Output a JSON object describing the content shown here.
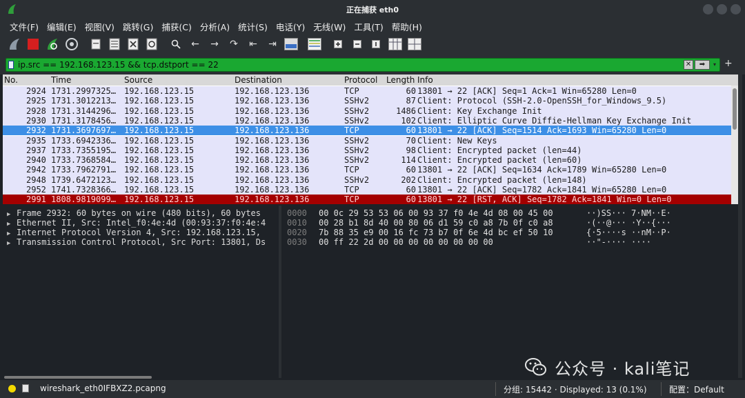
{
  "window": {
    "title": "正在捕获 eth0"
  },
  "menu": [
    "文件(F)",
    "编辑(E)",
    "视图(V)",
    "跳转(G)",
    "捕获(C)",
    "分析(A)",
    "统计(S)",
    "电话(Y)",
    "无线(W)",
    "工具(T)",
    "帮助(H)"
  ],
  "toolbar": {
    "icons": [
      "shark-fin-start-icon",
      "stop-capture-icon",
      "restart-capture-icon",
      "capture-options-icon",
      "open-file-icon",
      "save-file-icon",
      "close-file-icon",
      "reload-file-icon",
      "find-packet-icon",
      "go-back-icon",
      "go-forward-icon",
      "go-to-packet-icon",
      "first-packet-icon",
      "last-packet-icon",
      "autoscroll-icon",
      "colorize-icon",
      "zoom-in-icon",
      "zoom-out-icon",
      "normal-size-icon",
      "resize-columns-icon",
      "layout-icon"
    ]
  },
  "filter": {
    "expression": "ip.src == 192.168.123.15 && tcp.dstport == 22"
  },
  "columns": {
    "no": "No.",
    "time": "Time",
    "source": "Source",
    "destination": "Destination",
    "protocol": "Protocol",
    "length": "Length",
    "info": "Info"
  },
  "colors": {
    "row_default": "#e4e4fa",
    "row_selected": "#3d8fe6",
    "row_rst": "#a40000",
    "filter_valid": "#1aa831"
  },
  "packets": [
    {
      "no": "2924",
      "time": "1731.2997325…",
      "source": "192.168.123.15",
      "destination": "192.168.123.136",
      "protocol": "TCP",
      "length": "60",
      "info": "13801 → 22 [ACK] Seq=1 Ack=1 Win=65280 Len=0",
      "state": "normal"
    },
    {
      "no": "2925",
      "time": "1731.3012213…",
      "source": "192.168.123.15",
      "destination": "192.168.123.136",
      "protocol": "SSHv2",
      "length": "87",
      "info": "Client: Protocol (SSH-2.0-OpenSSH_for_Windows_9.5)",
      "state": "normal"
    },
    {
      "no": "2928",
      "time": "1731.3144296…",
      "source": "192.168.123.15",
      "destination": "192.168.123.136",
      "protocol": "SSHv2",
      "length": "1486",
      "info": "Client: Key Exchange Init",
      "state": "normal"
    },
    {
      "no": "2930",
      "time": "1731.3178456…",
      "source": "192.168.123.15",
      "destination": "192.168.123.136",
      "protocol": "SSHv2",
      "length": "102",
      "info": "Client: Elliptic Curve Diffie-Hellman Key Exchange Init",
      "state": "normal"
    },
    {
      "no": "2932",
      "time": "1731.3697697…",
      "source": "192.168.123.15",
      "destination": "192.168.123.136",
      "protocol": "TCP",
      "length": "60",
      "info": "13801 → 22 [ACK] Seq=1514 Ack=1693 Win=65280 Len=0",
      "state": "selected"
    },
    {
      "no": "2935",
      "time": "1733.6942336…",
      "source": "192.168.123.15",
      "destination": "192.168.123.136",
      "protocol": "SSHv2",
      "length": "70",
      "info": "Client: New Keys",
      "state": "normal"
    },
    {
      "no": "2937",
      "time": "1733.7355195…",
      "source": "192.168.123.15",
      "destination": "192.168.123.136",
      "protocol": "SSHv2",
      "length": "98",
      "info": "Client: Encrypted packet (len=44)",
      "state": "normal"
    },
    {
      "no": "2940",
      "time": "1733.7368584…",
      "source": "192.168.123.15",
      "destination": "192.168.123.136",
      "protocol": "SSHv2",
      "length": "114",
      "info": "Client: Encrypted packet (len=60)",
      "state": "normal"
    },
    {
      "no": "2942",
      "time": "1733.7962791…",
      "source": "192.168.123.15",
      "destination": "192.168.123.136",
      "protocol": "TCP",
      "length": "60",
      "info": "13801 → 22 [ACK] Seq=1634 Ack=1789 Win=65280 Len=0",
      "state": "normal"
    },
    {
      "no": "2948",
      "time": "1739.6472123…",
      "source": "192.168.123.15",
      "destination": "192.168.123.136",
      "protocol": "SSHv2",
      "length": "202",
      "info": "Client: Encrypted packet (len=148)",
      "state": "normal"
    },
    {
      "no": "2952",
      "time": "1741.7328366…",
      "source": "192.168.123.15",
      "destination": "192.168.123.136",
      "protocol": "TCP",
      "length": "60",
      "info": "13801 → 22 [ACK] Seq=1782 Ack=1841 Win=65280 Len=0",
      "state": "normal"
    },
    {
      "no": "2991",
      "time": "1808.9819099…",
      "source": "192.168.123.15",
      "destination": "192.168.123.136",
      "protocol": "TCP",
      "length": "60",
      "info": "13801 → 22 [RST, ACK] Seq=1782 Ack=1841 Win=0 Len=0",
      "state": "rst"
    }
  ],
  "details": [
    "Frame 2932: 60 bytes on wire (480 bits), 60 bytes",
    "Ethernet II, Src: Intel_f0:4e:4d (00:93:37:f0:4e:4",
    "Internet Protocol Version 4, Src: 192.168.123.15,",
    "Transmission Control Protocol, Src Port: 13801, Ds"
  ],
  "bytes": [
    {
      "offset": "0000",
      "hex": "00 0c 29 53 53 06 00 93  37 f0 4e 4d 08 00 45 00",
      "ascii": "··)SS··· 7·NM··E·"
    },
    {
      "offset": "0010",
      "hex": "00 28 b1 8d 40 00 80 06  d1 59 c0 a8 7b 0f c0 a8",
      "ascii": "·(··@··· ·Y··{···"
    },
    {
      "offset": "0020",
      "hex": "7b 88 35 e9 00 16 fc 73  b7 0f 6e 4d bc ef 50 10",
      "ascii": "{·5····s ··nM··P·"
    },
    {
      "offset": "0030",
      "hex": "00 ff 22 2d 00 00 00 00  00 00 00 00",
      "ascii": "··\"-···· ····"
    }
  ],
  "status": {
    "file": "wireshark_eth0IFBXZ2.pcapng",
    "packets": "分组: 15442 · Displayed: 13 (0.1%)",
    "profile": "配置：Default"
  },
  "watermark": {
    "text": "公众号 · kali笔记"
  }
}
